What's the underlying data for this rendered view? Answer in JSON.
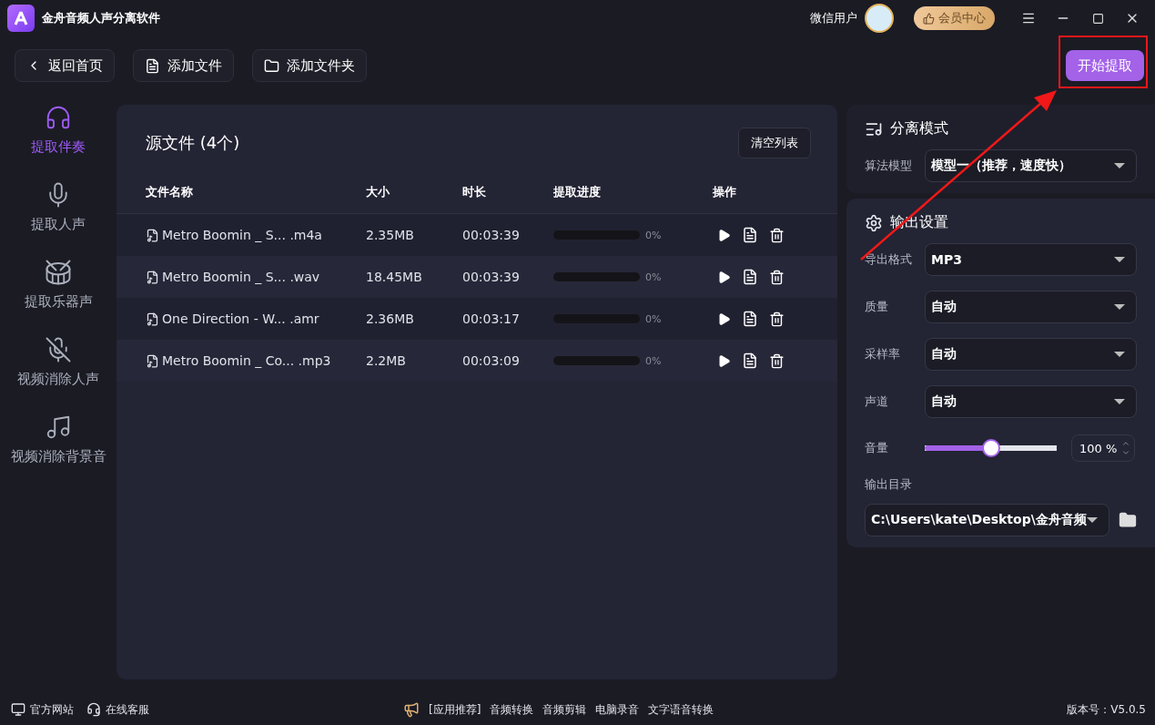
{
  "window": {
    "title": "金舟音频人声分离软件",
    "user": "微信用户",
    "vip_button": "会员中心"
  },
  "toolbar": {
    "back": "返回首页",
    "add_file": "添加文件",
    "add_folder": "添加文件夹",
    "start": "开始提取"
  },
  "annotation": {
    "kind": "arrow_box"
  },
  "sidebar": {
    "items": [
      {
        "label": "提取伴奏",
        "kind": "accompaniment",
        "selected": true
      },
      {
        "label": "提取人声",
        "kind": "vocal",
        "selected": false
      },
      {
        "label": "提取乐器声",
        "kind": "drum",
        "selected": false
      },
      {
        "label": "视频消除人声",
        "kind": "mute_vocal",
        "selected": false
      },
      {
        "label": "视频消除背景音",
        "kind": "mute_music",
        "selected": false
      }
    ]
  },
  "file_list": {
    "title": "源文件 (4个)",
    "clear_button": "清空列表",
    "columns": [
      "文件名称",
      "大小",
      "时长",
      "提取进度",
      "操作"
    ],
    "rows": [
      {
        "name": "Metro Boomin _ S...",
        "ext": ".m4a",
        "size": "2.35MB",
        "duration": "00:03:39",
        "level": 0,
        "progress": "0%"
      },
      {
        "name": "Metro Boomin _ S...",
        "ext": ".wav",
        "size": "18.45MB",
        "duration": "00:03:39",
        "level": 0,
        "progress": "0%"
      },
      {
        "name": "One Direction - W...",
        "ext": ".amr",
        "size": "2.36MB",
        "duration": "00:03:17",
        "level": 0,
        "progress": "0%"
      },
      {
        "name": "Metro Boomin _ Co...",
        "ext": ".mp3",
        "size": "2.2MB",
        "duration": "00:03:09",
        "level": 0,
        "progress": "0%"
      }
    ]
  },
  "separation": {
    "title": "分离模式",
    "label": "算法模型",
    "value": "模型一（推荐，速度快）"
  },
  "output": {
    "title": "输出设置",
    "selects": [
      {
        "label": "导出格式",
        "value": "MP3"
      },
      {
        "label": "质量",
        "value": "自动"
      },
      {
        "label": "采样率",
        "value": "自动"
      },
      {
        "label": "声道",
        "value": "自动"
      }
    ],
    "volume": {
      "label": "音量",
      "level": 0.5,
      "reading": "100 %"
    },
    "directory": {
      "label": "输出目录",
      "value": "C:\\Users\\kate\\Desktop\\金舟音频"
    }
  },
  "footer": {
    "links": [
      "官方网站",
      "在线客服"
    ],
    "promo_label": "[应用推荐]",
    "promos": [
      "音频转换",
      "音频剪辑",
      "电脑录音",
      "文字语音转换"
    ],
    "version": "版本号：V5.0.5"
  }
}
